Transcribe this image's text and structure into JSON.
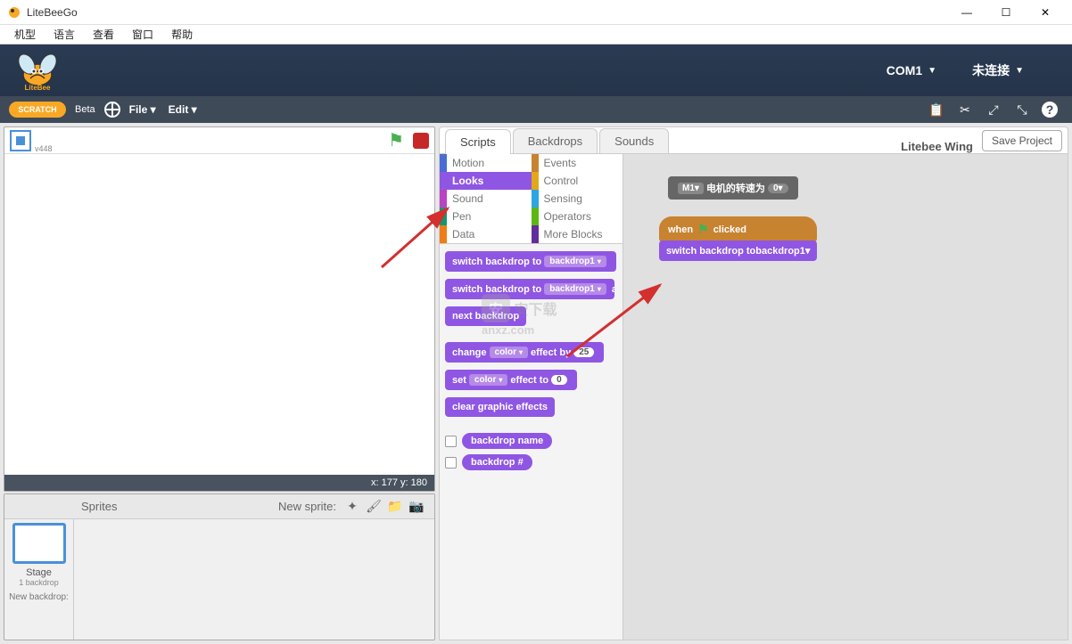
{
  "window": {
    "title": "LiteBeeGo"
  },
  "menubar": [
    "机型",
    "语言",
    "查看",
    "窗口",
    "帮助"
  ],
  "banner": {
    "port": "COM1",
    "connection": "未连接"
  },
  "stoolbar": {
    "beta": "Beta",
    "file": "File ▾",
    "edit": "Edit ▾",
    "scratch_logo": "SCRATCH"
  },
  "stage": {
    "id": "v448",
    "coords": "x: 177  y: 180"
  },
  "sprites": {
    "label": "Sprites",
    "new_label": "New sprite:",
    "stage_label": "Stage",
    "stage_sub": "1 backdrop",
    "new_backdrop": "New backdrop:"
  },
  "tabs": {
    "scripts": "Scripts",
    "backdrops": "Backdrops",
    "sounds": "Sounds",
    "project": "Litebee Wing",
    "save": "Save Project"
  },
  "categories": {
    "motion": "Motion",
    "looks": "Looks",
    "sound": "Sound",
    "pen": "Pen",
    "data": "Data",
    "events": "Events",
    "control": "Control",
    "sensing": "Sensing",
    "operators": "Operators",
    "more": "More Blocks"
  },
  "cat_colors": {
    "motion": "#4a6cd4",
    "looks": "#8f56e3",
    "sound": "#bb42c3",
    "pen": "#0e9a6c",
    "data": "#ee7d16",
    "events": "#c88330",
    "control": "#e1a91a",
    "sensing": "#2ca5e2",
    "operators": "#5cb712",
    "more": "#632d99"
  },
  "palette_blocks": {
    "switch_backdrop": "switch backdrop to",
    "switch_backdrop_wait": "switch backdrop to",
    "next_backdrop": "next backdrop",
    "change_effect": "change",
    "effect_by": "effect by",
    "set_effect": "set",
    "effect_to": "effect to",
    "clear_effects": "clear graphic effects",
    "backdrop_name": "backdrop name",
    "backdrop_num": "backdrop #",
    "slot_backdrop": "backdrop1",
    "slot_color": "color",
    "num25": "25",
    "num0": "0"
  },
  "canvas_blocks": {
    "ext_motor_prefix": "M1",
    "ext_motor_text": "电机的转速为",
    "ext_motor_val": "0",
    "when": "when",
    "clicked": "clicked",
    "switch_backdrop": "switch backdrop to",
    "backdrop1": "backdrop1"
  },
  "watermark": {
    "line1": "安下载",
    "line2": "anxz.com"
  }
}
